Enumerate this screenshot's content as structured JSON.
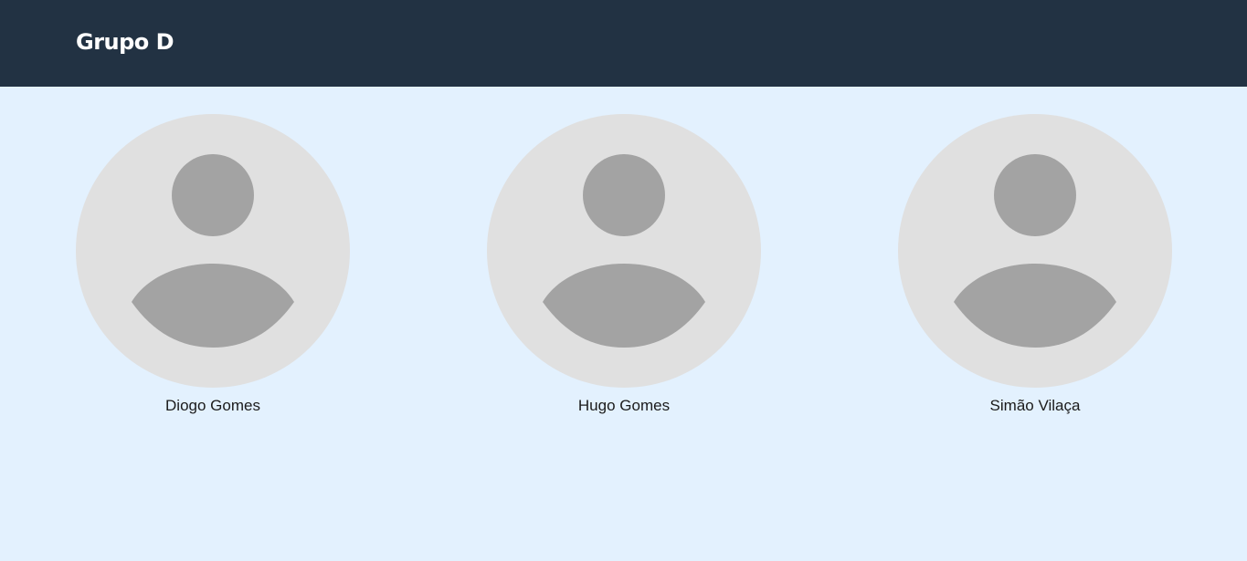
{
  "header": {
    "title": "Grupo D",
    "background": "#223243"
  },
  "members": [
    {
      "name": "Diogo Gomes",
      "icon": "person-avatar-icon"
    },
    {
      "name": "Hugo Gomes",
      "icon": "person-avatar-icon"
    },
    {
      "name": "Simão Vilaça",
      "icon": "person-avatar-icon"
    }
  ],
  "colors": {
    "page_background": "#e3f1fe",
    "avatar_background": "#e0e0e0",
    "avatar_figure": "#a3a3a3"
  }
}
